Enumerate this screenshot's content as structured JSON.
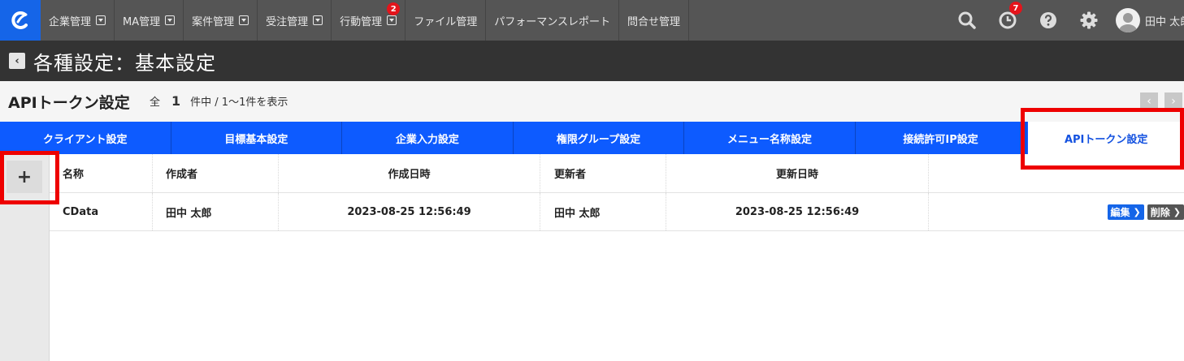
{
  "nav": {
    "items": [
      {
        "label": "企業管理",
        "dropdown": true
      },
      {
        "label": "MA管理",
        "dropdown": true
      },
      {
        "label": "案件管理",
        "dropdown": true
      },
      {
        "label": "受注管理",
        "dropdown": true
      },
      {
        "label": "行動管理",
        "dropdown": true,
        "badge": "2"
      },
      {
        "label": "ファイル管理",
        "dropdown": false
      },
      {
        "label": "パフォーマンスレポート",
        "dropdown": false
      },
      {
        "label": "問合せ管理",
        "dropdown": false
      }
    ],
    "history_badge": "7",
    "user_name": "田中 太郎"
  },
  "titlebar": {
    "back_label": "‹",
    "title": "各種設定：基本設定"
  },
  "subheader": {
    "section_title": "APIトークン設定",
    "total_prefix": "全",
    "total_count": "1",
    "range_text": "件中 /  1～1件を表示"
  },
  "tabs": [
    {
      "label": "クライアント設定",
      "active": false
    },
    {
      "label": "目標基本設定",
      "active": false
    },
    {
      "label": "企業入力設定",
      "active": false
    },
    {
      "label": "権限グループ設定",
      "active": false
    },
    {
      "label": "メニュー名称設定",
      "active": false
    },
    {
      "label": "接続許可IP設定",
      "active": false
    },
    {
      "label": "APIトークン設定",
      "active": true
    }
  ],
  "table": {
    "add_label": "+",
    "headers": [
      "名称",
      "作成者",
      "作成日時",
      "更新者",
      "更新日時"
    ],
    "rows": [
      {
        "name": "CData",
        "creator": "田中 太郎",
        "created_at": "2023-08-25 12:56:49",
        "updater": "田中 太郎",
        "updated_at": "2023-08-25 12:56:49"
      }
    ],
    "edit_label": "編集",
    "delete_label": "削除"
  },
  "colors": {
    "brand_blue": "#0d5bff",
    "nav_gray": "#555555",
    "highlight_red": "#ee0000",
    "badge_red": "#e4141b"
  }
}
